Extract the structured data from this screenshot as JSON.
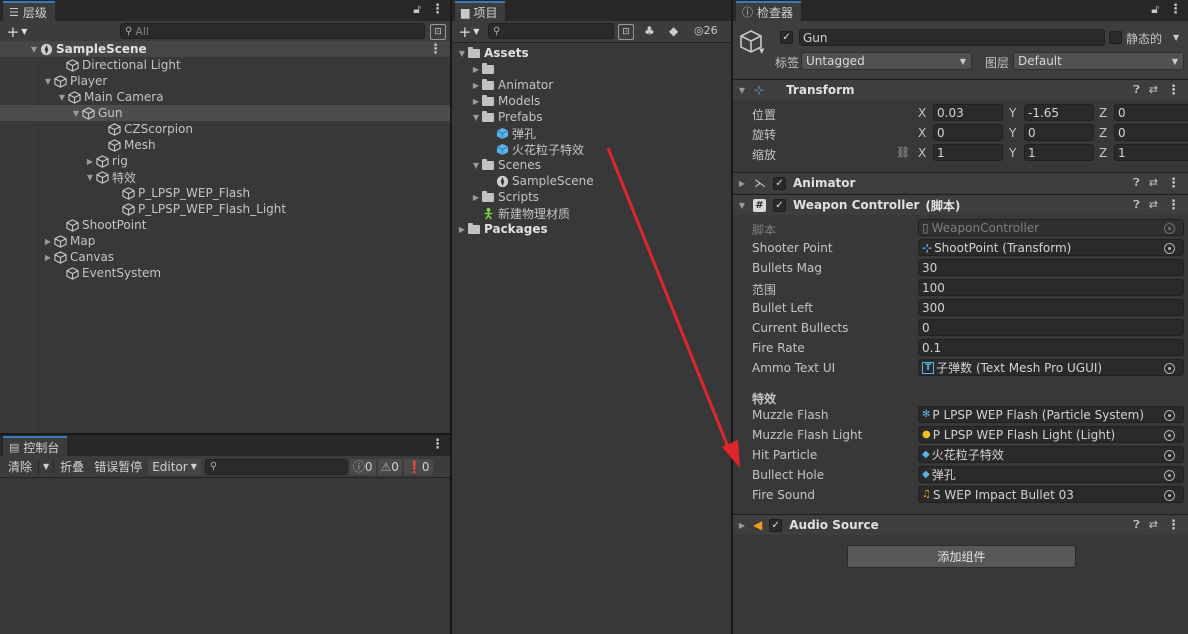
{
  "hierarchy": {
    "tab": "层级",
    "search_placeholder": "All",
    "items": [
      {
        "label": "SampleScene"
      },
      {
        "label": "Directional Light"
      },
      {
        "label": "Player"
      },
      {
        "label": "Main Camera"
      },
      {
        "label": "Gun"
      },
      {
        "label": "CZScorpion"
      },
      {
        "label": "Mesh"
      },
      {
        "label": "rig"
      },
      {
        "label": "特效"
      },
      {
        "label": "P_LPSP_WEP_Flash"
      },
      {
        "label": "P_LPSP_WEP_Flash_Light"
      },
      {
        "label": "ShootPoint"
      },
      {
        "label": "Map"
      },
      {
        "label": "Canvas"
      },
      {
        "label": "EventSystem"
      }
    ]
  },
  "project": {
    "tab": "项目",
    "count": "26",
    "items": [
      {
        "label": "Assets"
      },
      {
        "label": ""
      },
      {
        "label": "Animator"
      },
      {
        "label": "Models"
      },
      {
        "label": "Prefabs"
      },
      {
        "label": "弹孔"
      },
      {
        "label": "火花粒子特效"
      },
      {
        "label": "Scenes"
      },
      {
        "label": "SampleScene"
      },
      {
        "label": "Scripts"
      },
      {
        "label": "新建物理材质"
      },
      {
        "label": "Packages"
      }
    ]
  },
  "console": {
    "tab": "控制台",
    "clear": "清除",
    "collapse": "折叠",
    "error_pause": "错误暂停",
    "editor": "Editor",
    "log_count": "0",
    "warn_count": "0",
    "error_count": "0"
  },
  "inspector": {
    "tab": "检查器",
    "object_name": "Gun",
    "static_label": "静态的",
    "tag_label": "标签",
    "tag_value": "Untagged",
    "layer_label": "图层",
    "layer_value": "Default",
    "transform": {
      "title": "Transform",
      "position_label": "位置",
      "rotation_label": "旋转",
      "scale_label": "缩放",
      "axis_x": "X",
      "axis_y": "Y",
      "axis_z": "Z",
      "position": {
        "x": "0.03",
        "y": "-1.65",
        "z": "0"
      },
      "rotation": {
        "x": "0",
        "y": "0",
        "z": "0"
      },
      "scale": {
        "x": "1",
        "y": "1",
        "z": "1"
      }
    },
    "animator": {
      "title": "Animator"
    },
    "weapon": {
      "title": "Weapon Controller",
      "suffix": "(脚本)",
      "script_label": "脚本",
      "script_value": "WeaponController",
      "fields": [
        {
          "label": "Shooter Point",
          "value": "ShootPoint (Transform)"
        },
        {
          "label": "Bullets Mag",
          "value": "30"
        },
        {
          "label": "范围",
          "value": "100"
        },
        {
          "label": "Bullet Left",
          "value": "300"
        },
        {
          "label": "Current Bullects",
          "value": "0"
        },
        {
          "label": "Fire Rate",
          "value": "0.1"
        },
        {
          "label": "Ammo Text UI",
          "value": "子弹数 (Text Mesh Pro UGUI)"
        }
      ],
      "section_label": "特效",
      "fx_fields": [
        {
          "label": "Muzzle Flash",
          "value": "P LPSP WEP Flash (Particle System)"
        },
        {
          "label": "Muzzle Flash Light",
          "value": "P LPSP WEP Flash Light (Light)"
        },
        {
          "label": "Hit Particle",
          "value": "火花粒子特效"
        },
        {
          "label": "Bullect Hole",
          "value": "弹孔"
        },
        {
          "label": "Fire Sound",
          "value": "S WEP Impact Bullet 03"
        }
      ]
    },
    "audio": {
      "title": "Audio Source"
    },
    "add_component": "添加组件"
  },
  "colors": {
    "accent": "#3a79bb",
    "selection": "#4d4d4d",
    "arrow": "#e0262b"
  }
}
